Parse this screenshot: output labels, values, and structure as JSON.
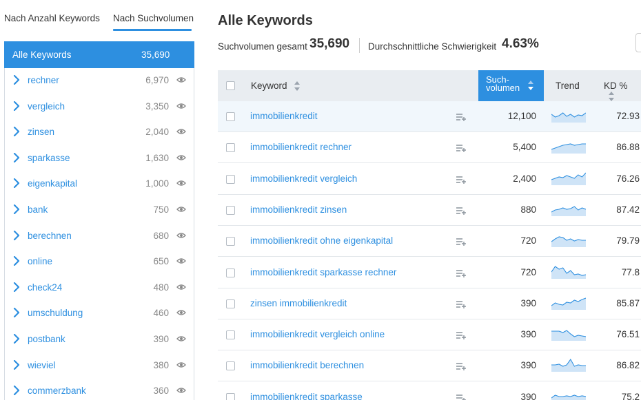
{
  "tabs": [
    {
      "label": "Nach Anzahl Keywords"
    },
    {
      "label": "Nach Suchvolumen"
    }
  ],
  "sidebar": {
    "all": {
      "label": "Alle Keywords",
      "value": "35,690"
    },
    "items": [
      {
        "label": "rechner",
        "value": "6,970"
      },
      {
        "label": "vergleich",
        "value": "3,350"
      },
      {
        "label": "zinsen",
        "value": "2,040"
      },
      {
        "label": "sparkasse",
        "value": "1,630"
      },
      {
        "label": "eigenkapital",
        "value": "1,000"
      },
      {
        "label": "bank",
        "value": "750"
      },
      {
        "label": "berechnen",
        "value": "680"
      },
      {
        "label": "online",
        "value": "650"
      },
      {
        "label": "check24",
        "value": "480"
      },
      {
        "label": "umschuldung",
        "value": "460"
      },
      {
        "label": "postbank",
        "value": "390"
      },
      {
        "label": "wieviel",
        "value": "380"
      },
      {
        "label": "commerzbank",
        "value": "360"
      }
    ]
  },
  "main": {
    "title": "Alle Keywords",
    "summary": {
      "volume_label": "Suchvolumen gesamt",
      "volume_value": "35,690",
      "difficulty_label": "Durchschnittliche Schwierigkeit",
      "difficulty_value": "4.63%"
    },
    "columns": {
      "keyword": "Keyword",
      "volume_line1": "Such-",
      "volume_line2": "volumen",
      "trend": "Trend",
      "kd": "KD %"
    },
    "rows": [
      {
        "keyword": "immobilienkredit",
        "volume": "12,100",
        "kd": "72.93",
        "trend": [
          0.6,
          0.4,
          0.5,
          0.7,
          0.45,
          0.6,
          0.4,
          0.55,
          0.5,
          0.7
        ]
      },
      {
        "keyword": "immobilienkredit rechner",
        "volume": "5,400",
        "kd": "86.88",
        "trend": [
          0.3,
          0.4,
          0.5,
          0.6,
          0.65,
          0.7,
          0.6,
          0.65,
          0.7,
          0.7
        ]
      },
      {
        "keyword": "immobilienkredit vergleich",
        "volume": "2,400",
        "kd": "76.26",
        "trend": [
          0.4,
          0.5,
          0.6,
          0.55,
          0.7,
          0.6,
          0.5,
          0.75,
          0.6,
          0.9
        ]
      },
      {
        "keyword": "immobilienkredit zinsen",
        "volume": "880",
        "kd": "87.42",
        "trend": [
          0.3,
          0.45,
          0.5,
          0.6,
          0.5,
          0.55,
          0.7,
          0.45,
          0.6,
          0.5
        ]
      },
      {
        "keyword": "immobilienkredit ohne eigenkapital",
        "volume": "720",
        "kd": "79.79",
        "trend": [
          0.4,
          0.6,
          0.75,
          0.7,
          0.5,
          0.6,
          0.45,
          0.55,
          0.5,
          0.5
        ]
      },
      {
        "keyword": "immobilienkredit sparkasse rechner",
        "volume": "720",
        "kd": "77.8",
        "trend": [
          0.5,
          0.9,
          0.7,
          0.8,
          0.4,
          0.6,
          0.3,
          0.35,
          0.25,
          0.3
        ]
      },
      {
        "keyword": "zinsen immobilienkredit",
        "volume": "390",
        "kd": "85.87",
        "trend": [
          0.3,
          0.5,
          0.4,
          0.35,
          0.55,
          0.5,
          0.7,
          0.6,
          0.75,
          0.85
        ]
      },
      {
        "keyword": "immobilienkredit vergleich online",
        "volume": "390",
        "kd": "76.51",
        "trend": [
          0.7,
          0.7,
          0.7,
          0.6,
          0.75,
          0.5,
          0.3,
          0.4,
          0.35,
          0.3
        ]
      },
      {
        "keyword": "immobilienkredit berechnen",
        "volume": "390",
        "kd": "86.82",
        "trend": [
          0.5,
          0.5,
          0.55,
          0.4,
          0.5,
          0.9,
          0.4,
          0.5,
          0.45,
          0.45
        ]
      },
      {
        "keyword": "immobilienkredit sparkasse",
        "volume": "390",
        "kd": "75.2",
        "trend": [
          0.4,
          0.6,
          0.5,
          0.5,
          0.55,
          0.5,
          0.6,
          0.5,
          0.55,
          0.5
        ]
      }
    ]
  },
  "colors": {
    "accent": "#2d8fe0",
    "trend_fill": "#cfe4f7",
    "trend_line": "#2d8fe0"
  },
  "icons": {
    "chevron": "chevron-right-icon",
    "eye": "eye-icon",
    "add": "add-to-list-icon",
    "sort": "sort-icon"
  }
}
